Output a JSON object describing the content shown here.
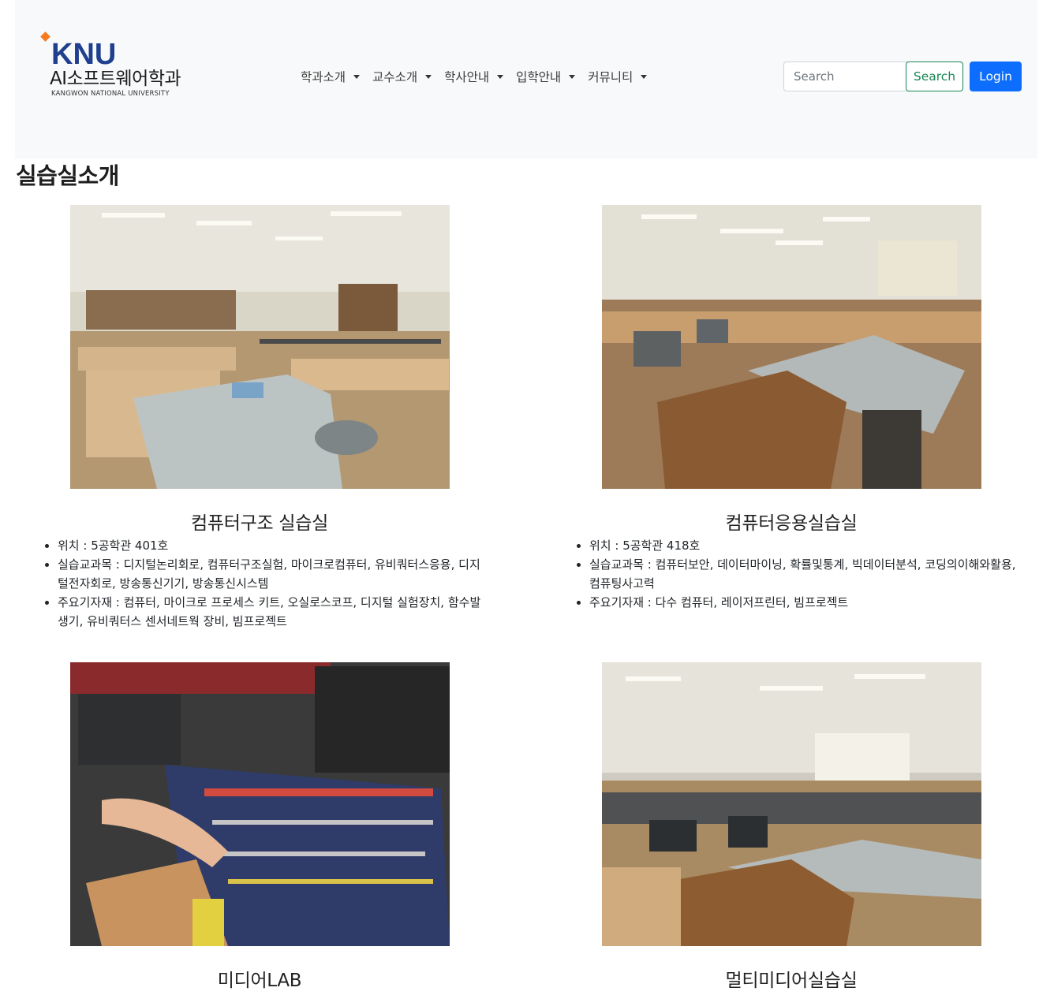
{
  "navbar": {
    "logo_text": "KNU",
    "dept_name": "AI소프트웨어학과",
    "univ_name": "KANGWON NATIONAL UNIVERSITY",
    "menu": [
      {
        "label": "학과소개"
      },
      {
        "label": "교수소개"
      },
      {
        "label": "학사안내"
      },
      {
        "label": "입학안내"
      },
      {
        "label": "커뮤니티"
      }
    ],
    "search_placeholder": "Search",
    "search_button": "Search",
    "login_button": "Login"
  },
  "page": {
    "title": "실습실소개"
  },
  "labs": [
    {
      "name": "컴퓨터구조 실습실",
      "details": [
        "위치 : 5공학관 401호",
        "실습교과목 : 디지털논리회로, 컴퓨터구조실험, 마이크로컴퓨터, 유비쿼터스응용, 디지털전자회로, 방송통신기기, 방송통신시스템",
        "주요기자재 : 컴퓨터, 마이크로 프로세스 키트, 오실로스코프, 디지털 실험장치, 함수발생기, 유비쿼터스 센서네트웍 장비, 빔프로젝트"
      ]
    },
    {
      "name": "컴퓨터응용실습실",
      "details": [
        "위치 : 5공학관 418호",
        "실습교과목 : 컴퓨터보안, 데이터마이닝, 확률및통계, 빅데이터분석, 코딩의이해와활용, 컴퓨팅사고력",
        "주요기자재 : 다수 컴퓨터, 레이저프린터, 빔프로젝트"
      ]
    },
    {
      "name": "미디어LAB",
      "details": []
    },
    {
      "name": "멀티미디어실습실",
      "details": []
    }
  ],
  "colors": {
    "navbar_bg": "#f8f9fa",
    "logo_blue": "#1f3f8f",
    "logo_orange": "#f47a20",
    "search_green": "#198754",
    "login_blue": "#0d6efd"
  }
}
